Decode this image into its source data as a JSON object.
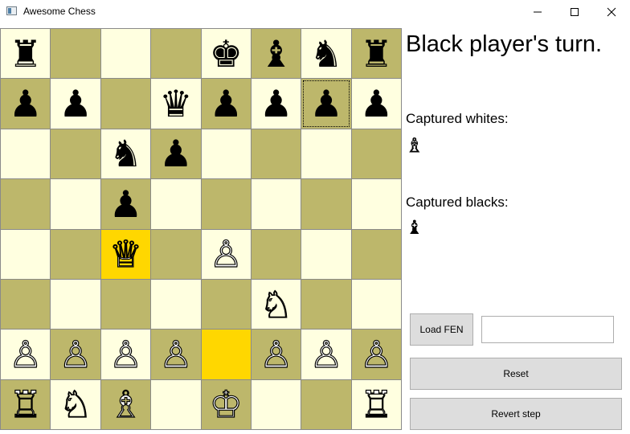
{
  "window": {
    "title": "Awesome Chess",
    "controls": [
      "minimize",
      "maximize",
      "close"
    ]
  },
  "board": {
    "rows": [
      [
        {
          "p": "♜",
          "c": "black"
        },
        {
          "p": "",
          "c": ""
        },
        {
          "p": "",
          "c": ""
        },
        {
          "p": "",
          "c": ""
        },
        {
          "p": "♚",
          "c": "black"
        },
        {
          "p": "♝",
          "c": "black"
        },
        {
          "p": "♞",
          "c": "black"
        },
        {
          "p": "♜",
          "c": "black"
        }
      ],
      [
        {
          "p": "♟",
          "c": "black"
        },
        {
          "p": "♟",
          "c": "black"
        },
        {
          "p": "",
          "c": ""
        },
        {
          "p": "♛",
          "c": "black"
        },
        {
          "p": "♟",
          "c": "black"
        },
        {
          "p": "♟",
          "c": "black"
        },
        {
          "p": "♟",
          "c": "black"
        },
        {
          "p": "♟",
          "c": "black"
        }
      ],
      [
        {
          "p": "",
          "c": ""
        },
        {
          "p": "",
          "c": ""
        },
        {
          "p": "♞",
          "c": "black"
        },
        {
          "p": "♟",
          "c": "black"
        },
        {
          "p": "",
          "c": ""
        },
        {
          "p": "",
          "c": ""
        },
        {
          "p": "",
          "c": ""
        },
        {
          "p": "",
          "c": ""
        }
      ],
      [
        {
          "p": "",
          "c": ""
        },
        {
          "p": "",
          "c": ""
        },
        {
          "p": "♟",
          "c": "black"
        },
        {
          "p": "",
          "c": ""
        },
        {
          "p": "",
          "c": ""
        },
        {
          "p": "",
          "c": ""
        },
        {
          "p": "",
          "c": ""
        },
        {
          "p": "",
          "c": ""
        }
      ],
      [
        {
          "p": "",
          "c": ""
        },
        {
          "p": "",
          "c": ""
        },
        {
          "p": "♕",
          "c": "white"
        },
        {
          "p": "",
          "c": ""
        },
        {
          "p": "♙",
          "c": "white"
        },
        {
          "p": "",
          "c": ""
        },
        {
          "p": "",
          "c": ""
        },
        {
          "p": "",
          "c": ""
        }
      ],
      [
        {
          "p": "",
          "c": ""
        },
        {
          "p": "",
          "c": ""
        },
        {
          "p": "",
          "c": ""
        },
        {
          "p": "",
          "c": ""
        },
        {
          "p": "",
          "c": ""
        },
        {
          "p": "♘",
          "c": "white"
        },
        {
          "p": "",
          "c": ""
        },
        {
          "p": "",
          "c": ""
        }
      ],
      [
        {
          "p": "♙",
          "c": "white"
        },
        {
          "p": "♙",
          "c": "white"
        },
        {
          "p": "♙",
          "c": "white"
        },
        {
          "p": "♙",
          "c": "white"
        },
        {
          "p": "",
          "c": ""
        },
        {
          "p": "♙",
          "c": "white"
        },
        {
          "p": "♙",
          "c": "white"
        },
        {
          "p": "♙",
          "c": "white"
        }
      ],
      [
        {
          "p": "♖",
          "c": "white"
        },
        {
          "p": "♘",
          "c": "white"
        },
        {
          "p": "♗",
          "c": "white"
        },
        {
          "p": "",
          "c": ""
        },
        {
          "p": "♔",
          "c": "white"
        },
        {
          "p": "",
          "c": ""
        },
        {
          "p": "",
          "c": ""
        },
        {
          "p": "♖",
          "c": "white"
        }
      ]
    ],
    "highlighted": [
      [
        4,
        2
      ],
      [
        6,
        4
      ]
    ],
    "focused": [
      1,
      6
    ],
    "colors": {
      "light": "#ffffe0",
      "dark": "#bdb76b",
      "highlight": "#ffd700"
    }
  },
  "status": {
    "turn_text": "Black player's turn."
  },
  "captured": {
    "whites_label": "Captured whites:",
    "whites": [
      "♗"
    ],
    "blacks_label": "Captured blacks:",
    "blacks": [
      "♝"
    ]
  },
  "controls": {
    "load_fen_label": "Load FEN",
    "fen_value": "",
    "fen_placeholder": "",
    "reset_label": "Reset",
    "revert_label": "Revert step"
  }
}
